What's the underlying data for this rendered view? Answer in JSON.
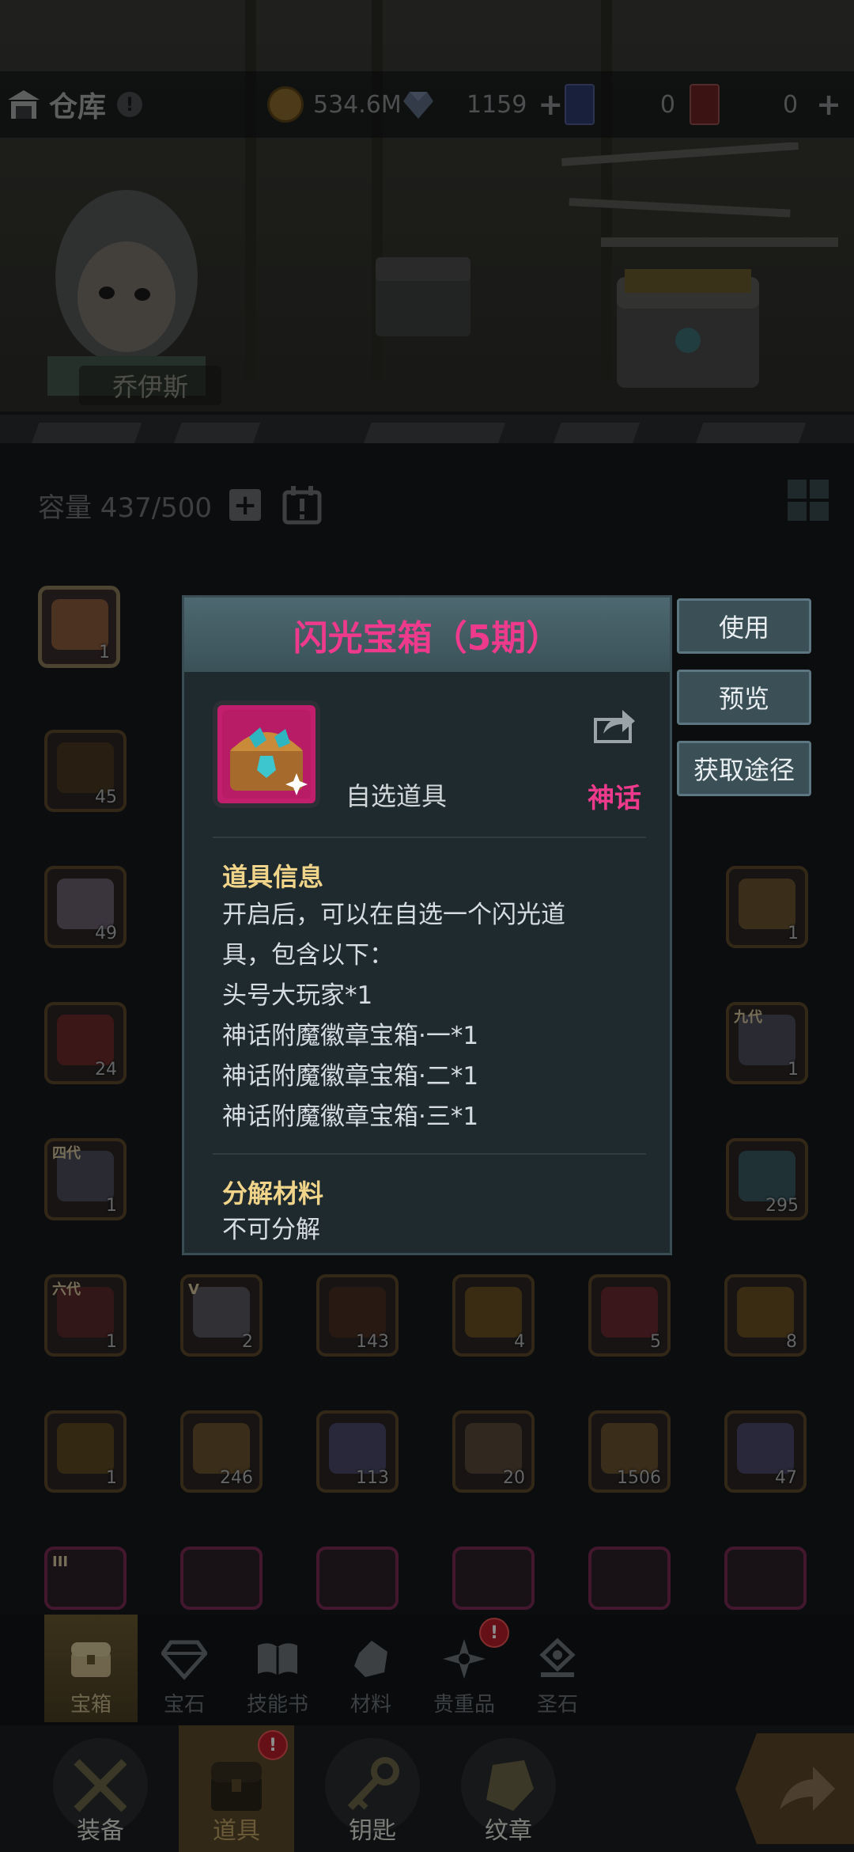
{
  "header": {
    "title": "仓库",
    "alert": "!",
    "gold": "534.6M",
    "crystal": "1159",
    "card_blue": "0",
    "card_red": "0",
    "plus": "+"
  },
  "scene": {
    "hero_name": "乔伊斯"
  },
  "capacity": {
    "label": "容量 437/500",
    "plus": "+"
  },
  "popup": {
    "title": "闪光宝箱（5期）",
    "item_type": "自选道具",
    "rarity": "神话",
    "info_title": "道具信息",
    "info_lines": [
      "开启后，可以在自选一个闪光道",
      "具，包含以下：",
      "头号大玩家*1",
      "神话附魔徽章宝箱·一*1",
      "神话附魔徽章宝箱·二*1",
      "神话附魔徽章宝箱·三*1"
    ],
    "decompose_title": "分解材料",
    "decompose_value": "不可分解"
  },
  "actions": {
    "use": "使用",
    "preview": "预览",
    "source": "获取途径"
  },
  "grid": {
    "row0": [
      {
        "qty": "1"
      }
    ],
    "col1": [
      {
        "qty": "45"
      },
      {
        "qty": "49"
      },
      {
        "qty": "24"
      },
      {
        "qty": "1",
        "tag": "四代"
      }
    ],
    "right_col": [
      {
        "qty": "1"
      },
      {
        "qty": "1",
        "tag": "九代"
      },
      {
        "qty": "295"
      }
    ],
    "row_a": [
      {
        "qty": "1",
        "tag": "六代"
      },
      {
        "qty": "2",
        "tag": "V"
      },
      {
        "qty": "143"
      },
      {
        "qty": "4"
      },
      {
        "qty": "5"
      },
      {
        "qty": "8"
      }
    ],
    "row_b": [
      {
        "qty": "1"
      },
      {
        "qty": "246"
      },
      {
        "qty": "113"
      },
      {
        "qty": "20"
      },
      {
        "qty": "1506"
      },
      {
        "qty": "47"
      }
    ],
    "row_c_tag": "III"
  },
  "categories": {
    "items": [
      "宝箱",
      "宝石",
      "技能书",
      "材料",
      "贵重品",
      "圣石"
    ],
    "badge": "!"
  },
  "nav": {
    "items": [
      "装备",
      "道具",
      "钥匙",
      "纹章"
    ],
    "badge": "!"
  },
  "colors": {
    "mythic": "#ee3a8c",
    "section_title": "#f0d48a",
    "button_bg": "#3b4f57"
  }
}
